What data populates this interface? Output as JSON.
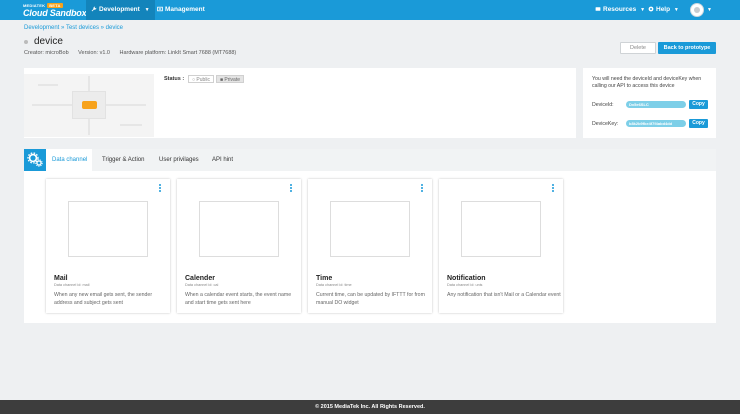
{
  "nav": {
    "brand_small": "MEDIATEK",
    "brand_beta": "BETA",
    "brand_big": "Cloud Sandbox",
    "development": "Development",
    "management": "Management",
    "resources": "Resources",
    "help": "Help"
  },
  "breadcrumb": [
    "Development",
    "Test devices",
    "device"
  ],
  "breadcrumb_sep": "»",
  "device": {
    "title": "device",
    "creator": "Creator: microBob",
    "version": "Version: v1.0",
    "platform": "Hardware platform: LinkIt Smart 7688 (MT7688)",
    "status_label": "Status :",
    "status_public": "Public",
    "status_private": "Private",
    "status_selected": "Private"
  },
  "actions": {
    "delete": "Delete",
    "back": "Back to prototype"
  },
  "keys": {
    "note": "You will need the deviceId and deviceKey when calling our API to access this device",
    "device_id_label": "DeviceId:",
    "device_id_value": "Dx5e6SLC",
    "device_key_label": "DeviceKey:",
    "device_key_value": "b8k2b9fke4f7f4abd4dd",
    "copy": "Copy"
  },
  "tabs": [
    "Data channel",
    "Trigger & Action",
    "User privilages",
    "API hint"
  ],
  "cards": [
    {
      "title": "Mail",
      "sub": "Data channel id: mail",
      "desc": "When any new email gets sent, the sender address and subject gets sent"
    },
    {
      "title": "Calender",
      "sub": "Data channel id: cal",
      "desc": "When a calendar event starts, the event name and start time gets sent here"
    },
    {
      "title": "Time",
      "sub": "Data channel id: time",
      "desc": "Current time, can be updated by IFTTT for from manual DO widget"
    },
    {
      "title": "Notification",
      "sub": "Data channel id: unis",
      "desc": "Any notification that isn't Mail or a Calendar event"
    }
  ],
  "footer": "© 2015 MediaTek Inc. All Rights Reserved.",
  "colors": {
    "primary": "#1a9ad8",
    "accent": "#f7a21b",
    "footer": "#3d3d3d"
  }
}
